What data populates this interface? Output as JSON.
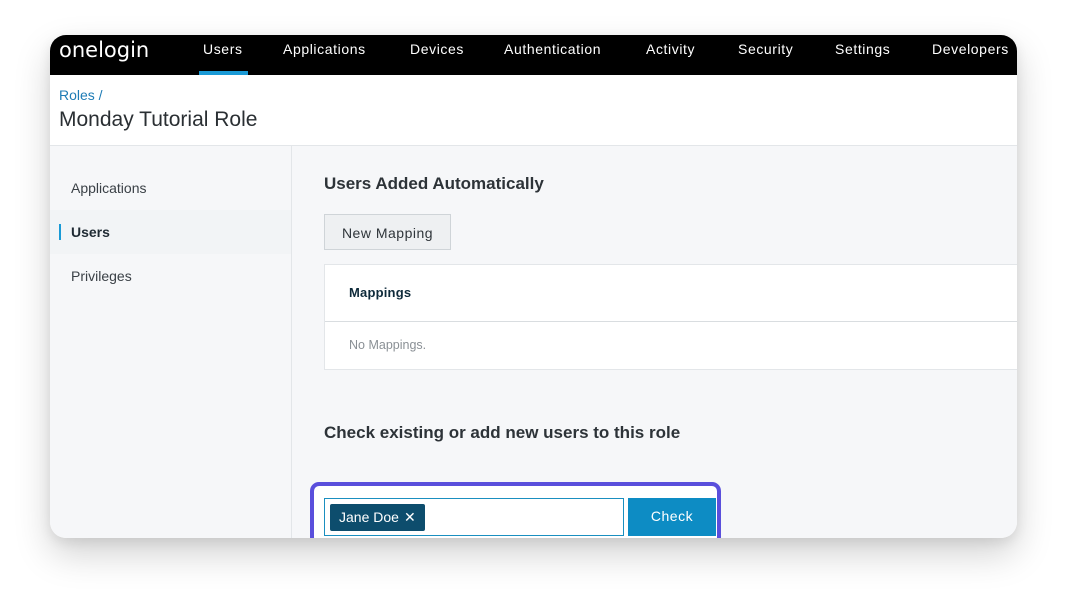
{
  "brand": {
    "logo_text": "onelogin",
    "accent": "#1a9ad6",
    "highlight": "#5a4fdc"
  },
  "nav": {
    "items": [
      {
        "label": "Users",
        "active": true
      },
      {
        "label": "Applications"
      },
      {
        "label": "Devices"
      },
      {
        "label": "Authentication"
      },
      {
        "label": "Activity"
      },
      {
        "label": "Security"
      },
      {
        "label": "Settings"
      },
      {
        "label": "Developers"
      }
    ]
  },
  "header": {
    "breadcrumb": "Roles /",
    "title": "Monday Tutorial Role"
  },
  "sidebar": {
    "items": [
      {
        "label": "Applications"
      },
      {
        "label": "Users",
        "active": true
      },
      {
        "label": "Privileges"
      }
    ]
  },
  "main": {
    "auto_title": "Users Added Automatically",
    "new_mapping_label": "New Mapping",
    "mappings": {
      "header": "Mappings",
      "empty_text": "No Mappings."
    },
    "check_title": "Check existing or add new users to this role",
    "selected_user": "Jane Doe",
    "remove_icon": "close-icon",
    "check_label": "Check"
  }
}
